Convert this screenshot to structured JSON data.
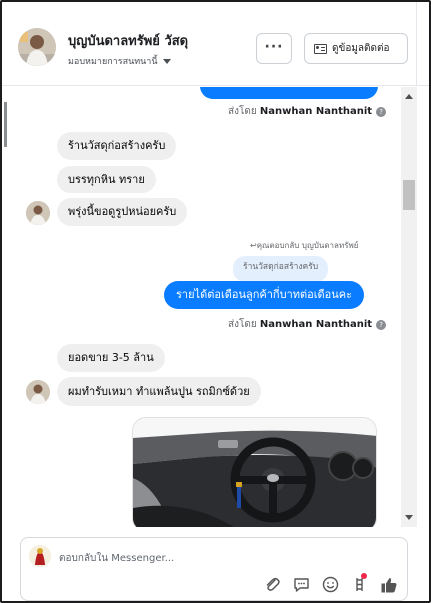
{
  "header": {
    "name": "บุญบันดาลทรัพย์ วัสดุ",
    "assign_label": "มอบหมายการสนทนานี้",
    "more_label": "···",
    "contact_label": "ดูข้อมูลติดต่อ"
  },
  "messages": {
    "sent_by_1": {
      "prefix": "ส่งโดย",
      "agent": "Nanwhan Nanthanit"
    },
    "in_1": "ร้านวัสดุก่อสร้างครับ",
    "in_2": "บรรทุกหิน ทราย",
    "in_3": "พรุ่งนี้ขอดูรูปหน่อยครับ",
    "replied_note": "คุณตอบกลับ บุญบันดาลทรัพย์",
    "replied_icon": "↩",
    "quoted": "ร้านวัสดุก่อสร้างครับ",
    "out_1": "รายได้ต่อเดือนลูกค้ากี่บาทต่อเดือนคะ",
    "sent_by_2": {
      "prefix": "ส่งโดย",
      "agent": "Nanwhan Nanthanit"
    },
    "in_4": "ยอดขาย 3-5 ล้าน",
    "in_5": "ผมทำรับเหมา ทำแพล้นปูน รถมิกซ์ด้วย",
    "help_icon": "?"
  },
  "composer": {
    "placeholder": "ตอบกลับใน Messenger..."
  },
  "colors": {
    "outgoing_bubble": "#0a7cff",
    "incoming_bubble": "#efefef",
    "accent": "#1877f2"
  },
  "icons": [
    "more-icon",
    "contact-card-icon",
    "caret-down-icon",
    "help-icon",
    "attachment-icon",
    "saved-reply-icon",
    "emoji-icon",
    "apps-icon",
    "like-icon"
  ]
}
